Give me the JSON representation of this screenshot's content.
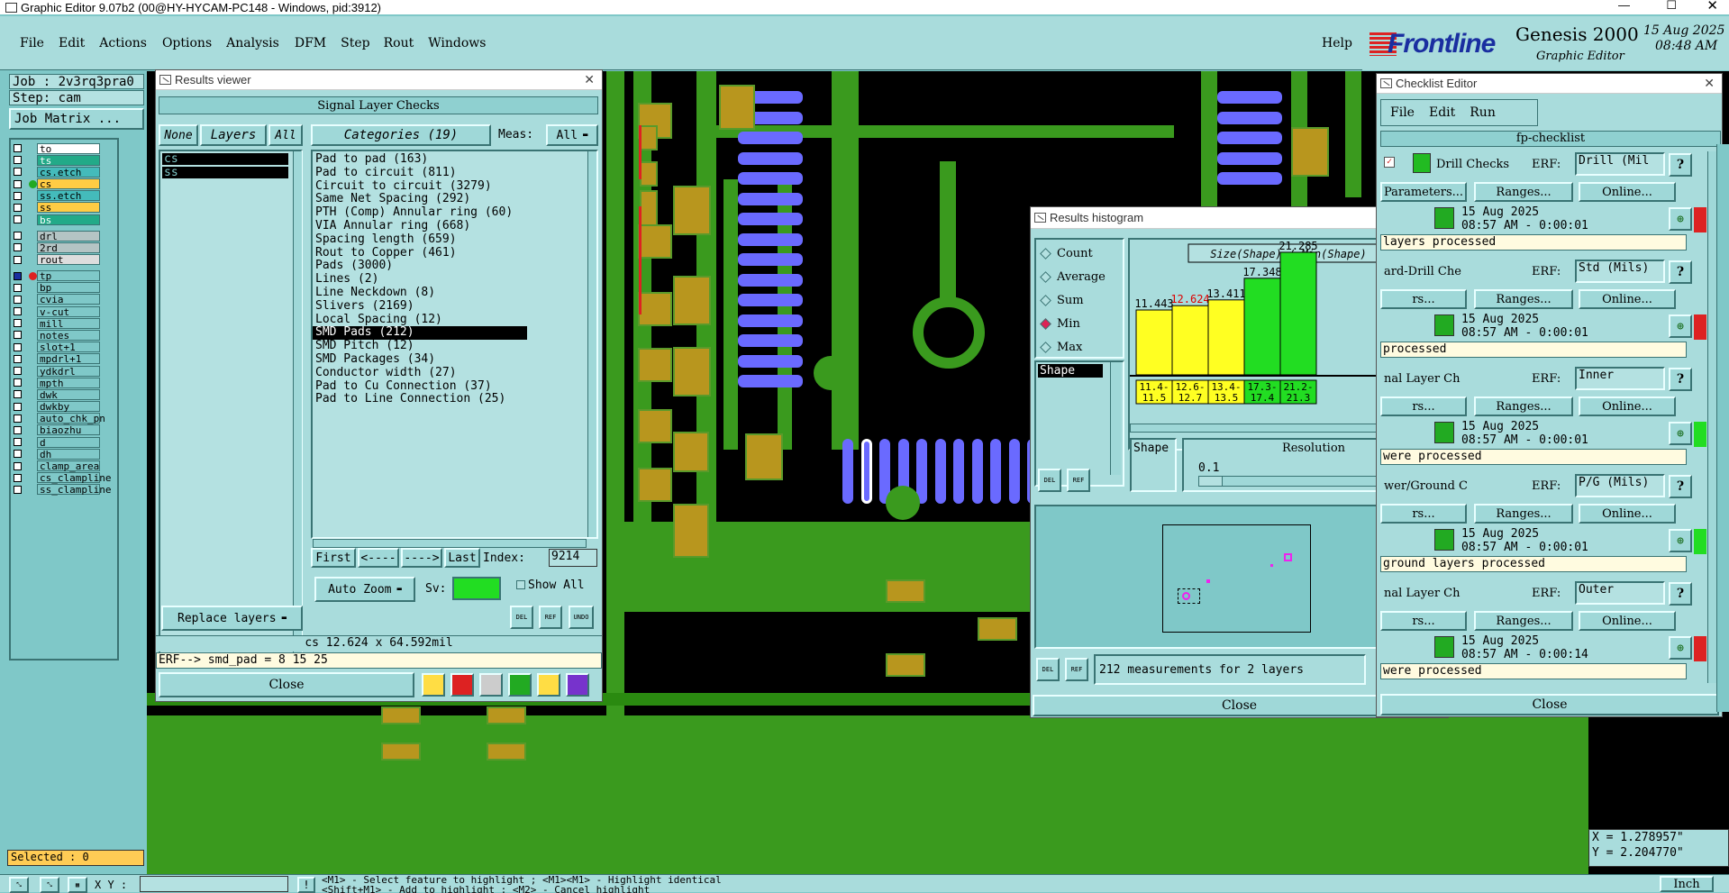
{
  "window": {
    "title": "Graphic Editor 9.07b2 (00@HY-HYCAM-PC148 - Windows, pid:3912)"
  },
  "menu": {
    "items": [
      "File",
      "Edit",
      "Actions",
      "Options",
      "Analysis",
      "DFM",
      "Step",
      "Rout",
      "Windows"
    ],
    "help": "Help"
  },
  "brand": {
    "logo": "Frontline",
    "product": "Genesis 2000",
    "subtitle": "Graphic Editor",
    "date": "15 Aug 2025",
    "time": "08:48 AM"
  },
  "left_panel": {
    "job": "Job : 2v3rq3pra0",
    "step": "Step: cam",
    "job_matrix": "Job Matrix ...",
    "layers": [
      "to",
      "ts",
      "cs.etch",
      "cs",
      "ss.etch",
      "ss",
      "bs",
      "drl",
      "2rd",
      "rout",
      "tp",
      "bp",
      "cvia",
      "v-cut",
      "mill",
      "notes",
      "slot+1",
      "mpdrl+1",
      "ydkdrl",
      "mpth",
      "dwk",
      "dwkby",
      "auto_chk_pn",
      "biaozhu",
      "d",
      "dh",
      "clamp_area",
      "cs_clampline",
      "ss_clampline"
    ],
    "selected": "Selected : 0"
  },
  "results_viewer": {
    "title": "Results viewer",
    "header": "Signal Layer Checks",
    "none_btn": "None",
    "layers_btn": "Layers",
    "all_btn": "All",
    "layers_list": [
      "cs",
      "ss"
    ],
    "categories_btn": "Categories (19)",
    "meas_label": "Meas:",
    "meas_value": "All",
    "categories": [
      "Pad to pad (163)",
      "Pad to circuit (811)",
      "Circuit to circuit (3279)",
      "Same Net Spacing (292)",
      "PTH (Comp) Annular ring (60)",
      "VIA Annular ring (668)",
      "Spacing length (659)",
      "Rout to Copper (461)",
      "Pads (3000)",
      "Lines (2)",
      "Line Neckdown (8)",
      "Slivers (2169)",
      "Local Spacing (12)",
      "SMD Pads (212)",
      "SMD Pitch (12)",
      "SMD Packages (34)",
      "Conductor width (27)",
      "Pad to Cu Connection (37)",
      "Pad to Line Connection (25)"
    ],
    "selected_category": 13,
    "first": "First",
    "prev": "<----",
    "next": "---->",
    "last": "Last",
    "index_label": "Index:",
    "index_value": "9214",
    "auto_zoom": "Auto Zoom",
    "sv_label": "Sv:",
    "show_all": "Show All",
    "replace_layers": "Replace layers",
    "status": "cs 12.624 x 64.592mil",
    "erf": "ERF--> smd_pad = 8 15 25",
    "close": "Close",
    "del": "DEL",
    "ref": "REF",
    "undo": "UNDO"
  },
  "histogram": {
    "title": "Results histogram",
    "modes": [
      "Count",
      "Average",
      "Sum",
      "Min",
      "Max"
    ],
    "selected_mode": "Min",
    "list_item": "Shape",
    "chart_title": "Size(Shape) / Min(Shape)",
    "shape_label": "Shape",
    "resolution_label": "Resolution",
    "resolution_value": "0.1",
    "summary": "212 measurements for 2 layers",
    "close": "Close",
    "del": "DEL",
    "ref": "REF"
  },
  "chart_data": {
    "type": "bar",
    "title": "Size(Shape) / Min(Shape)",
    "categories": [
      "11.4-11.5",
      "12.6-12.7",
      "13.4-13.5",
      "17.3-17.4",
      "21.2-21.3"
    ],
    "values": [
      11.443,
      12.624,
      13.411,
      17.348,
      21.285
    ],
    "value_labels": [
      "11.443",
      "12.624",
      "13.411",
      "17.348",
      "21.285"
    ],
    "bin_top": [
      "11.4-",
      "12.6-",
      "13.4-",
      "17.3-",
      "21.2-"
    ],
    "bin_bottom": [
      "11.5",
      "12.7",
      "13.5",
      "17.4",
      "21.3"
    ],
    "heights": [
      0.45,
      0.48,
      0.52,
      0.67,
      0.85
    ],
    "colors": [
      "#ffff22",
      "#ffff22",
      "#ffff22",
      "#22dd22",
      "#22dd22"
    ],
    "label_colors": [
      "#000000",
      "#dd0000",
      "#000000",
      "#000000",
      "#000000"
    ]
  },
  "checklist": {
    "title": "Checklist Editor",
    "menu": [
      "File",
      "Edit",
      "Run"
    ],
    "name": "fp-checklist",
    "parameters": "Parameters...",
    "ranges": "Ranges...",
    "online": "Online...",
    "erf_label": "ERF:",
    "items": [
      {
        "name": "Drill Checks",
        "erf": "Drill (Mil",
        "date": "15 Aug 2025",
        "time": "08:57 AM - 0:00:01",
        "status": "layers processed",
        "prefix": "Parameters..."
      },
      {
        "name": "ard-Drill Che",
        "erf": "Std (Mils)",
        "date": "15 Aug 2025",
        "time": "08:57 AM - 0:00:01",
        "status": "processed",
        "prefix": "rs..."
      },
      {
        "name": "nal Layer Ch",
        "erf": "Inner",
        "date": "15 Aug 2025",
        "time": "08:57 AM - 0:00:01",
        "status": "were processed",
        "prefix": "rs..."
      },
      {
        "name": "wer/Ground C",
        "erf": "P/G (Mils)",
        "date": "15 Aug 2025",
        "time": "08:57 AM - 0:00:01",
        "status": "ground layers processed",
        "prefix": "rs..."
      },
      {
        "name": "nal Layer Ch",
        "erf": "Outer",
        "date": "15 Aug 2025",
        "time": "08:57 AM - 0:00:14",
        "status": "were processed",
        "prefix": "rs..."
      }
    ],
    "close": "Close"
  },
  "coords": {
    "x": "X = 1.278957\"",
    "y": "Y = 2.204770\""
  },
  "bottom": {
    "xy_label": "X Y :",
    "hint1": "<M1> - Select feature to highlight ; <M1><M1> - Highlight identical",
    "hint2": "<Shift+M1> - Add to highlight ; <M2> - Cancel highlight",
    "units": "Inch"
  }
}
